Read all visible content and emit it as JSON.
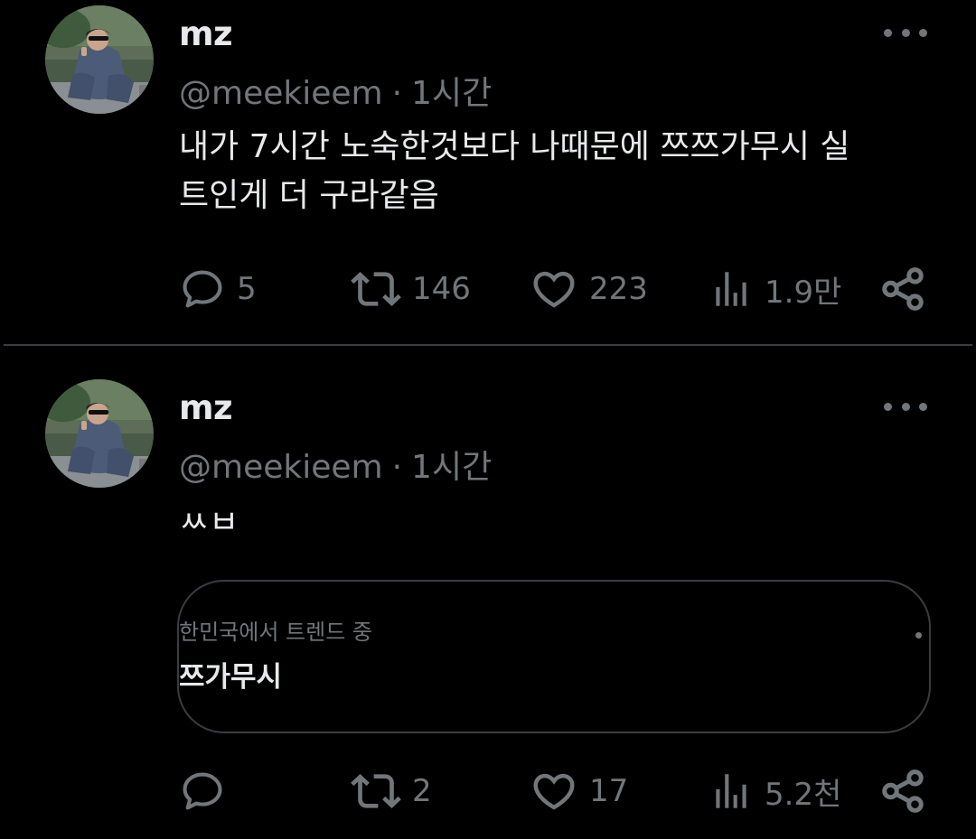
{
  "tweets": [
    {
      "display_name": "mz",
      "handle": "@meekieem",
      "separator": "·",
      "time": "1시간",
      "text_line1": "내가 7시간 노숙한것보다 나때문에 쯔쯔가무시 실",
      "text_line2": "트인게 더 구라같음",
      "reply_count": "5",
      "retweet_count": "146",
      "like_count": "223",
      "view_count": "1.9만",
      "icons": [
        "reply-icon",
        "retweet-icon",
        "like-icon",
        "views-icon",
        "share-icon",
        "more-icon"
      ]
    },
    {
      "display_name": "mz",
      "handle": "@meekieem",
      "separator": "·",
      "time": "1시간",
      "text_line1": "ㅆㅂ",
      "trend_context": "한민국에서 트렌드 중",
      "trend_title": "쯔가무시",
      "reply_count": "",
      "retweet_count": "2",
      "like_count": "17",
      "view_count": "5.2천",
      "icons": [
        "reply-icon",
        "retweet-icon",
        "like-icon",
        "views-icon",
        "share-icon",
        "more-icon"
      ]
    }
  ],
  "colors": {
    "background": "#000000",
    "primary_text": "#e7e9ea",
    "secondary_text": "#71767b",
    "divider": "#3c3f42"
  }
}
